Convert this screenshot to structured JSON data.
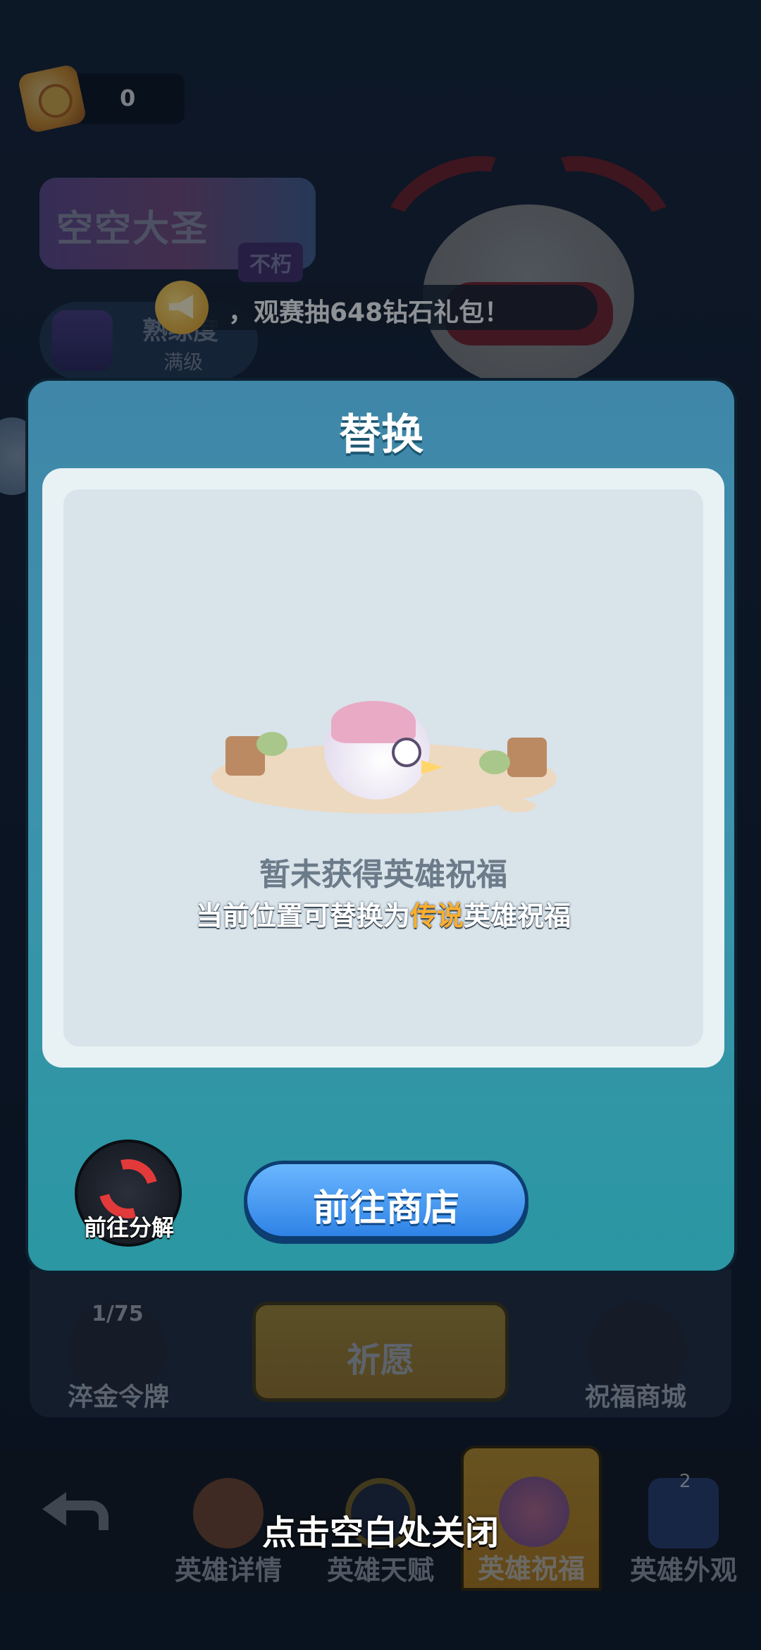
{
  "currency": {
    "icon": "treasure-scroll-icon",
    "value": "0"
  },
  "hero": {
    "name": "空空大圣",
    "tag": "不朽"
  },
  "proficiency": {
    "label": "熟练度",
    "level": "满级"
  },
  "announcement": {
    "icon": "megaphone-icon",
    "text": "，观赛抽648钻石礼包！"
  },
  "modal": {
    "title": "替换",
    "empty_title": "暂未获得英雄祝福",
    "empty_sub_prefix": "当前位置可替换为",
    "empty_sub_highlight": "传说",
    "empty_sub_suffix": "英雄祝福",
    "decompose_label": "前往分解",
    "shop_button": "前往商店"
  },
  "lower": {
    "token_progress": "1/75",
    "token_label": "淬金令牌",
    "wish_label": "祈愿",
    "shop_label": "祝福商城"
  },
  "bottom_nav": {
    "tabs": [
      {
        "label": "英雄详情",
        "icon": "bag-icon"
      },
      {
        "label": "英雄天赋",
        "icon": "talent-ring-icon"
      },
      {
        "label": "英雄祝福",
        "icon": "star-blessing-icon",
        "active": true
      },
      {
        "label": "英雄外观",
        "icon": "shirt-icon",
        "badge": "2"
      }
    ]
  },
  "close_hint": "点击空白处关闭",
  "colors": {
    "modal_top": "#3f86a8",
    "modal_bottom": "#2a97a2",
    "highlight": "#ffae2b",
    "shop_button": "#2f83e6"
  }
}
